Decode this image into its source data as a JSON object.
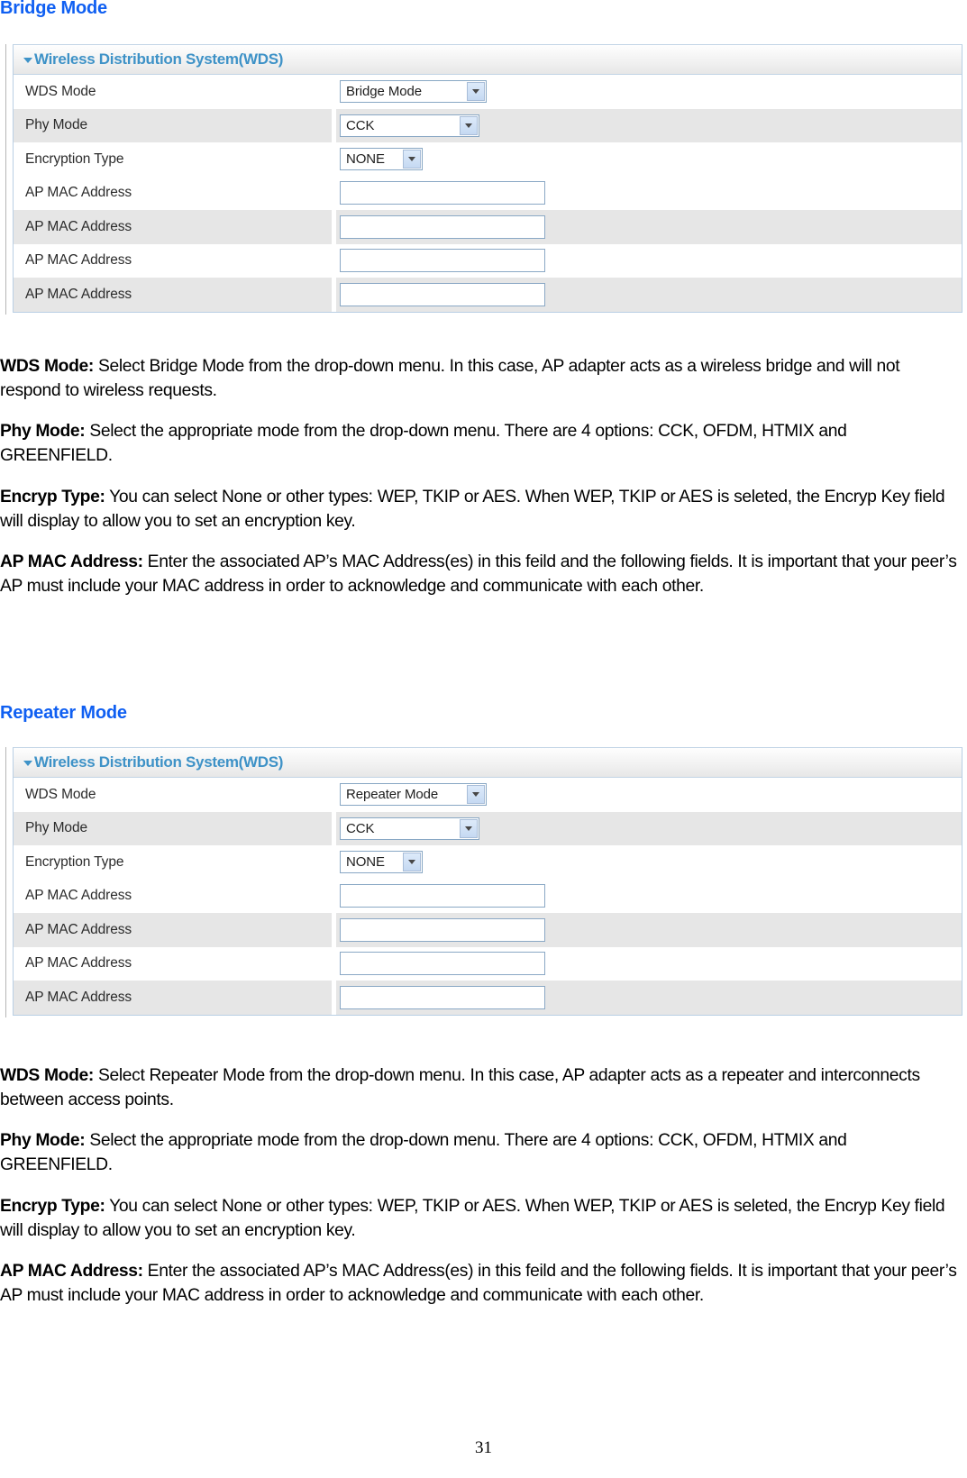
{
  "document": {
    "page_number": "31"
  },
  "sections": [
    {
      "heading": "Bridge Mode",
      "panel": {
        "title": "Wireless Distribution System(WDS)",
        "caret_icon": "triangle-down-icon",
        "rows": [
          {
            "label": "WDS Mode",
            "control": "select",
            "value": "Bridge Mode"
          },
          {
            "label": "Phy Mode",
            "control": "select",
            "value": "CCK"
          },
          {
            "label": "Encryption Type",
            "control": "select",
            "value": "NONE"
          },
          {
            "label": "AP MAC Address",
            "control": "textinput",
            "value": ""
          },
          {
            "label": "AP MAC Address",
            "control": "textinput",
            "value": ""
          },
          {
            "label": "AP MAC Address",
            "control": "textinput",
            "value": ""
          },
          {
            "label": "AP MAC Address",
            "control": "textinput",
            "value": ""
          }
        ]
      },
      "paragraphs": {
        "wds_mode_label": "WDS Mode:",
        "wds_mode_text": " Select Bridge Mode from the drop-down menu. In this case, AP adapter acts as a wireless bridge and will not respond to wireless requests.",
        "phy_mode_label": "Phy Mode:",
        "phy_mode_text": " Select the appropriate mode from the drop-down menu. There are 4 options: CCK, OFDM, HTMIX and GREENFIELD.",
        "encryp_type_label": "Encryp Type:",
        "encryp_type_text": " You can select None or other types: WEP, TKIP or AES. When  WEP, TKIP or AES is seleted, the Encryp Key field will display to allow you to set an encryption key.",
        "ap_mac_label": "AP MAC Address:",
        "ap_mac_text": "  Enter the associated AP’s MAC Address(es) in this feild and the following fields. It is important that your peer’s AP must include your MAC address in order to acknowledge and communicate with each other."
      }
    },
    {
      "heading": "Repeater Mode",
      "panel": {
        "title": "Wireless Distribution System(WDS)",
        "caret_icon": "triangle-down-icon",
        "rows": [
          {
            "label": "WDS Mode",
            "control": "select",
            "value": "Repeater Mode"
          },
          {
            "label": "Phy Mode",
            "control": "select",
            "value": "CCK"
          },
          {
            "label": "Encryption Type",
            "control": "select",
            "value": "NONE"
          },
          {
            "label": "AP MAC Address",
            "control": "textinput",
            "value": ""
          },
          {
            "label": "AP MAC Address",
            "control": "textinput",
            "value": ""
          },
          {
            "label": "AP MAC Address",
            "control": "textinput",
            "value": ""
          },
          {
            "label": "AP MAC Address",
            "control": "textinput",
            "value": ""
          }
        ]
      },
      "paragraphs": {
        "wds_mode_label": "WDS Mode:",
        "wds_mode_text": " Select Repeater Mode from the drop-down menu. In this case, AP adapter acts as a repeater and interconnects between access points.",
        "phy_mode_label": "Phy Mode:",
        "phy_mode_text": " Select the appropriate mode from the drop-down menu. There are 4 options: CCK, OFDM, HTMIX and GREENFIELD.",
        "encryp_type_label": "Encryp Type:",
        "encryp_type_text": " You can select None or other types: WEP, TKIP or AES. When  WEP, TKIP or AES is seleted, the Encryp Key field will display to allow you to set an encryption key.",
        "ap_mac_label": "AP MAC Address:",
        "ap_mac_text": "  Enter the associated AP’s MAC Address(es) in this feild and the following fields. It is important that your peer’s AP must include your MAC address in order to acknowledge and communicate with each other."
      }
    }
  ],
  "colors": {
    "heading_blue": "#0f5ff2",
    "panel_title_blue": "#3e92c7",
    "panel_border": "#b9cfe4",
    "row_alt_background": "#e6e6e6",
    "control_border": "#88a7c4",
    "select_button": "#c5d9f2"
  }
}
